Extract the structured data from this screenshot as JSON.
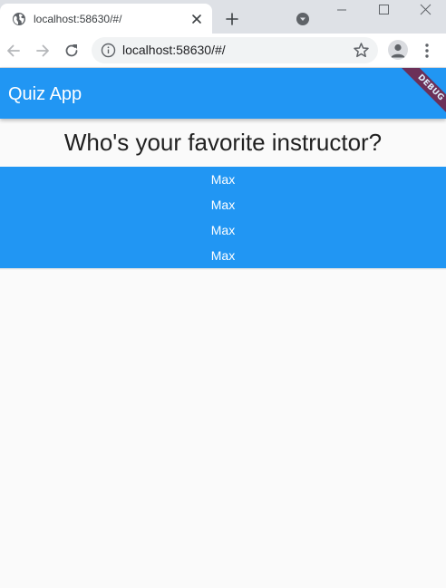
{
  "browser": {
    "tab_title": "localhost:58630/#/",
    "url": "localhost:58630/#/"
  },
  "app": {
    "appbar_title": "Quiz App",
    "debug_banner": "DEBUG",
    "question": "Who's your favorite instructor?",
    "answers": [
      "Max",
      "Max",
      "Max",
      "Max"
    ],
    "colors": {
      "primary": "#2196f3",
      "background": "#fafafa",
      "debug_banner": "#7a1f3d"
    }
  }
}
